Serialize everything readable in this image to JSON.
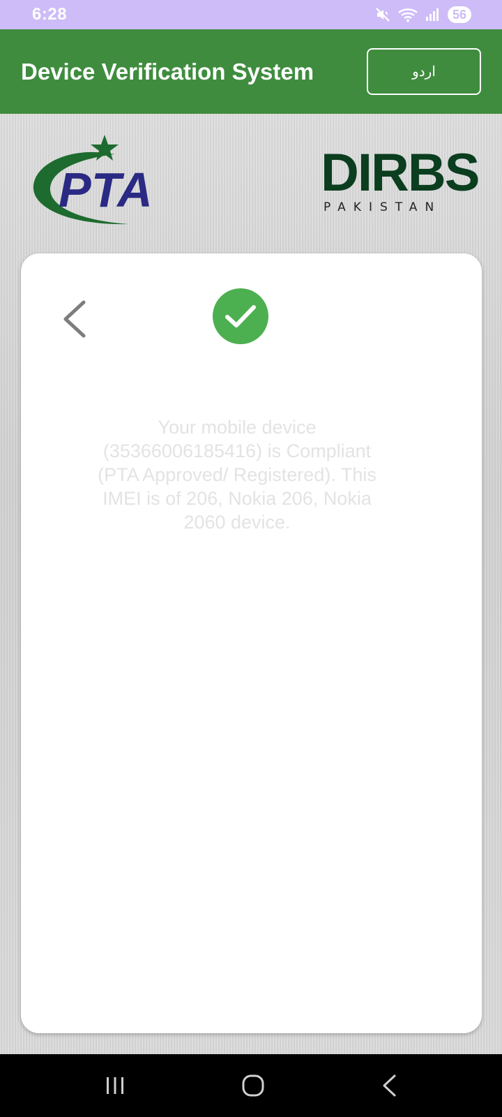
{
  "status_bar": {
    "time": "6:28",
    "battery": "56"
  },
  "app_bar": {
    "title": "Device Verification System",
    "language_button": "اردو"
  },
  "logos": {
    "pta": "PTA",
    "dirbs": "DIRBS",
    "dirbs_sub": "PAKISTAN"
  },
  "result": {
    "message": "Your mobile device (35366006185416) is Compliant (PTA Approved/ Registered). This IMEI is of 206, Nokia 206, Nokia 2060 device."
  },
  "colors": {
    "status_bar": "#cdbcf7",
    "app_bar": "#3f8c3f",
    "check": "#4cb050",
    "pta_blue": "#2a2a84",
    "pta_green": "#1d6b2e",
    "dirbs_green": "#0b3d1f"
  },
  "icons": {
    "status": [
      "mute-icon",
      "wifi-icon",
      "signal-icon"
    ],
    "card": [
      "back-chevron-icon",
      "check-icon"
    ],
    "nav": [
      "recents-icon",
      "home-icon",
      "back-icon"
    ]
  }
}
